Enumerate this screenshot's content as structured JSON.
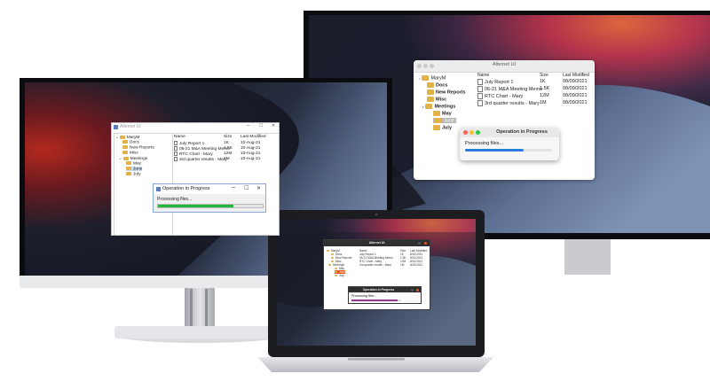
{
  "app_title": "Alternet UI",
  "tree": {
    "root": "MaryM",
    "docs": "Docs",
    "new_reports": "New Reports",
    "misc": "Misc",
    "meetings": "Meetings",
    "may": "May",
    "june": "June",
    "july": "July"
  },
  "columns": {
    "name": "Name",
    "size": "Size",
    "modified": "Last Modified"
  },
  "files": [
    {
      "name": "July Report 1",
      "size": "1K"
    },
    {
      "name": "06-21 M&A Meeting Memo",
      "size": "1.5K"
    },
    {
      "name": "RTC Chart - Mary",
      "size": "12M"
    },
    {
      "name": "3rd quarter results - Mary",
      "size": "1M"
    }
  ],
  "dates": {
    "windows": "10-Aug-21",
    "mac": "08/09/2021",
    "linux": "8/10/2021"
  },
  "progress": {
    "title": "Operation in Progress",
    "label": "Processing files...",
    "windows_fraction": 0.72,
    "mac_fraction": 0.67,
    "linux_fraction": 0.92,
    "windows_color": "#23b53d",
    "mac_color": "#2b7ddb",
    "linux_color": "#8e3a8a"
  },
  "window_controls": {
    "minimize": "–",
    "maximize": "☐",
    "close": "✕"
  },
  "colors": {
    "linux_titlebar": "#2f2f2f",
    "linux_accent": "#e95420",
    "mac_red": "#ff5f57",
    "mac_yellow": "#febc2e",
    "mac_green": "#28c840"
  }
}
